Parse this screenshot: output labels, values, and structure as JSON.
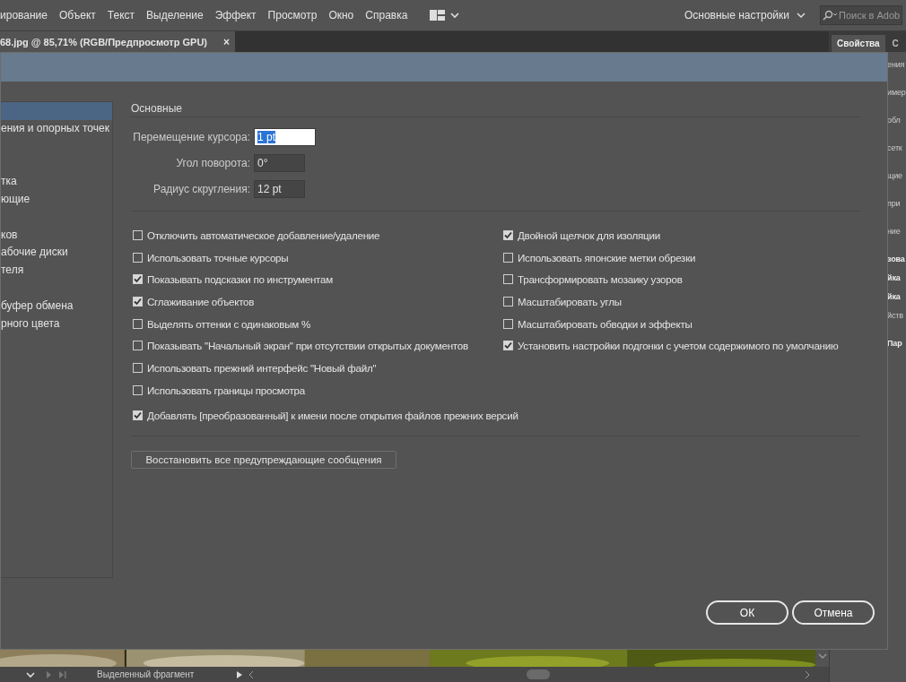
{
  "menu": [
    "ирование",
    "Объект",
    "Текст",
    "Выделение",
    "Эффект",
    "Просмотр",
    "Окно",
    "Справка"
  ],
  "workspace": "Основные настройки",
  "search": {
    "placeholder": "Поиск в Adob"
  },
  "document_tab": {
    "title": "68.jpg @ 85,71% (RGB/Предпросмотр GPU)",
    "close": "×"
  },
  "right_panel": {
    "tabs": [
      {
        "label": "Свойства",
        "selected": true
      },
      {
        "label": "С",
        "selected": false
      }
    ],
    "rows": [
      {
        "text": "ения",
        "bold": false
      },
      {
        "text": "имер",
        "bold": false
      },
      {
        "text": "обл",
        "bold": false
      },
      {
        "text": "сетк",
        "bold": false
      },
      {
        "text": "щие",
        "bold": false
      },
      {
        "text": "при",
        "bold": false
      },
      {
        "text": "ние",
        "bold": false
      },
      {
        "text": "зова",
        "bold": true
      },
      {
        "text": "йка",
        "bold": true
      },
      {
        "text": "йка",
        "bold": true
      },
      {
        "text": "йств",
        "bold": false
      },
      {
        "text": "Пар",
        "bold": true
      }
    ]
  },
  "dialog": {
    "sidebar": [
      {
        "kind": "item",
        "selected": true
      },
      {
        "kind": "item",
        "label": "ения и опорных точек",
        "selected": false
      },
      {
        "kind": "blank"
      },
      {
        "kind": "blank"
      },
      {
        "kind": "item",
        "label": "тка",
        "selected": false
      },
      {
        "kind": "item",
        "label": "ющие",
        "selected": false
      },
      {
        "kind": "blank"
      },
      {
        "kind": "item",
        "label": "ков",
        "selected": false
      },
      {
        "kind": "item",
        "label": "абочие диски",
        "selected": false
      },
      {
        "kind": "item",
        "label": "теля",
        "selected": false
      },
      {
        "kind": "blank"
      },
      {
        "kind": "item",
        "label": "буфер обмена",
        "selected": false
      },
      {
        "kind": "item",
        "label": "рного цвета",
        "selected": false
      }
    ],
    "section": "Основные",
    "fields": [
      {
        "label": "Перемещение курсора:",
        "value": "1 pt",
        "selected": true
      },
      {
        "label": "Угол поворота:",
        "value": "0°",
        "selected": false
      },
      {
        "label": "Радиус скругления:",
        "value": "12 pt",
        "selected": false
      }
    ],
    "options_left": [
      {
        "label": "Отключить автоматическое добавление/удаление",
        "checked": false
      },
      {
        "label": "Использовать точные курсоры",
        "checked": false
      },
      {
        "label": "Показывать подсказки по инструментам",
        "checked": true
      },
      {
        "label": "Сглаживание объектов",
        "checked": true
      },
      {
        "label": "Выделять оттенки с одинаковым %",
        "checked": false
      },
      {
        "label": "Показывать \"Начальный экран\" при отсутствии открытых документов",
        "checked": false
      },
      {
        "label": "Использовать прежний интерфейс \"Новый файл\"",
        "checked": false
      },
      {
        "label": "Использовать границы просмотра",
        "checked": false
      }
    ],
    "options_right": [
      {
        "label": "Двойной щелчок для изоляции",
        "checked": true
      },
      {
        "label": "Использовать японские метки обрезки",
        "checked": false
      },
      {
        "label": "Трансформировать мозаику узоров",
        "checked": false
      },
      {
        "label": "Масштабировать углы",
        "checked": false
      },
      {
        "label": "Масштабировать обводки и эффекты",
        "checked": false
      },
      {
        "label": "Установить настройки подгонки с учетом содержимого по умолчанию",
        "checked": true
      }
    ],
    "option_bottom": {
      "label": "Добавлять [преобразованный] к имени после открытия файлов прежних версий",
      "checked": true
    },
    "reset_button": "Восстановить все предупреждающие сообщения",
    "ok": "ОК",
    "cancel": "Отмена"
  },
  "status_bar": {
    "selection": "Выделенный фрагмент"
  }
}
